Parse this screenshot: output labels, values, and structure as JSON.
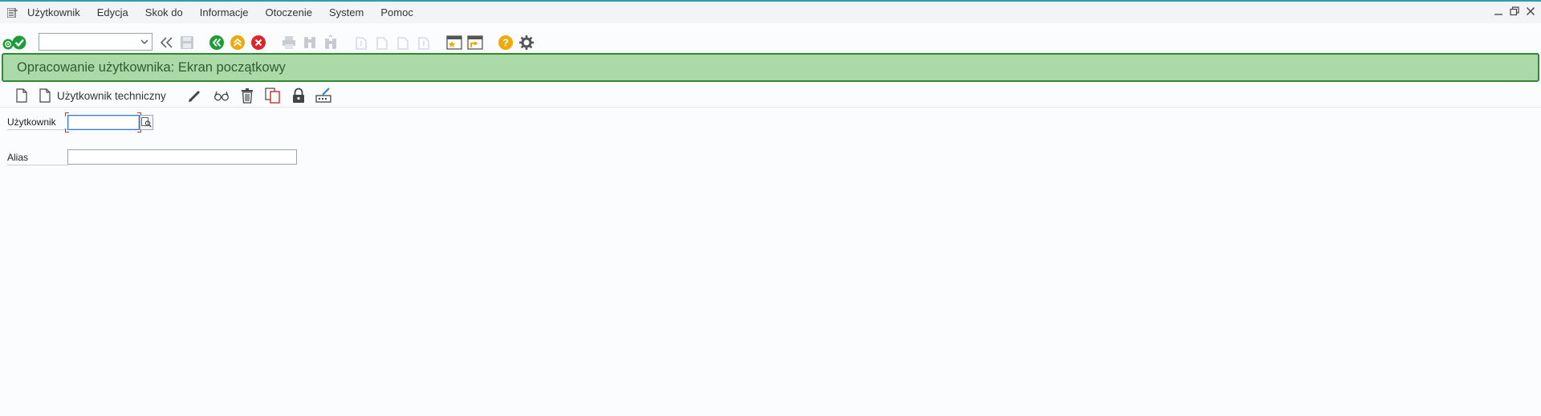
{
  "menubar": {
    "items": [
      "Użytkownik",
      "Edycja",
      "Skok do",
      "Informacje",
      "Otoczenie",
      "System",
      "Pomoc"
    ]
  },
  "toolbar": {
    "command_field_value": ""
  },
  "title": {
    "text": "Opracowanie użytkownika: Ekran początkowy"
  },
  "app_toolbar": {
    "technical_user_label": "Użytkownik techniczny"
  },
  "form": {
    "user_label": "Użytkownik",
    "user_value": "",
    "alias_label": "Alias",
    "alias_value": ""
  },
  "colors": {
    "title_background": "#acd9a8",
    "title_border": "#2f8a37",
    "ok_green": "#1f9c3a",
    "back_green": "#1f9c3a",
    "exit_orange": "#f0a90a",
    "cancel_red": "#d9262c",
    "help_orange": "#f0a90a"
  },
  "icons": {
    "menu": "sap-menu-icon",
    "toolbar": [
      "enter-icon",
      "back-arrows-icon",
      "save-icon",
      "back-icon",
      "exit-icon",
      "cancel-icon",
      "print-icon",
      "find-icon",
      "find-next-icon",
      "first-page-icon",
      "previous-page-icon",
      "next-page-icon",
      "last-page-icon",
      "create-session-icon",
      "create-shortcut-icon",
      "help-icon",
      "customize-icon"
    ],
    "app_toolbar": [
      "create-icon",
      "technical-user-icon",
      "change-pencil-icon",
      "display-glasses-icon",
      "delete-trash-icon",
      "copy-icon",
      "lock-icon",
      "change-password-icon"
    ]
  }
}
